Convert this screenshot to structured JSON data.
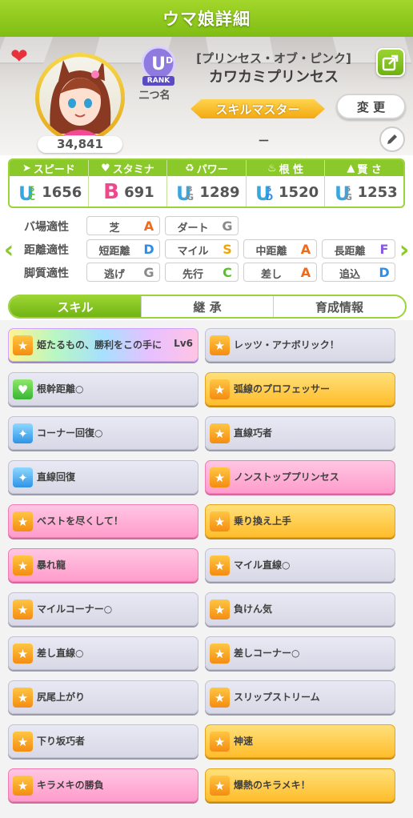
{
  "header": {
    "title": "ウマ娘詳細"
  },
  "profile": {
    "fans": "34,841",
    "rank_label": "RANK",
    "nickname": "二つ名",
    "epithet": "[プリンセス・オブ・ピンク]",
    "name": "カワカミプリンセス",
    "title_badge": "スキルマスター",
    "change_label": "変 更",
    "title_value": "－"
  },
  "stats": [
    {
      "label": "スピード",
      "grade": "UC5",
      "value": "1656"
    },
    {
      "label": "スタミナ",
      "grade": "B",
      "value": "691"
    },
    {
      "label": "パワー",
      "grade": "UG8",
      "value": "1289"
    },
    {
      "label": "根 性",
      "grade": "UD5",
      "value": "1520"
    },
    {
      "label": "賢 さ",
      "grade": "UG5",
      "value": "1253"
    }
  ],
  "aptitude": {
    "rows": [
      {
        "label": "バ場適性",
        "cells": [
          {
            "name": "芝",
            "grade": "A"
          },
          {
            "name": "ダート",
            "grade": "G"
          }
        ]
      },
      {
        "label": "距離適性",
        "cells": [
          {
            "name": "短距離",
            "grade": "D"
          },
          {
            "name": "マイル",
            "grade": "S"
          },
          {
            "name": "中距離",
            "grade": "A"
          },
          {
            "name": "長距離",
            "grade": "F"
          }
        ]
      },
      {
        "label": "脚質適性",
        "cells": [
          {
            "name": "逃げ",
            "grade": "G"
          },
          {
            "name": "先行",
            "grade": "C"
          },
          {
            "name": "差し",
            "grade": "A"
          },
          {
            "name": "追込",
            "grade": "D"
          }
        ]
      }
    ]
  },
  "tabs": [
    "スキル",
    "継 承",
    "育成情報"
  ],
  "skills": [
    {
      "name": "姫たるもの、勝利をこの手に",
      "level": "Lv6",
      "style": "rainbow",
      "icon": "yellow"
    },
    {
      "name": "レッツ・アナボリック！",
      "style": "normal",
      "icon": "yellow"
    },
    {
      "name": "根幹距離○",
      "style": "normal",
      "icon": "green"
    },
    {
      "name": "弧線のプロフェッサー",
      "style": "gold",
      "icon": "yellow"
    },
    {
      "name": "コーナー回復○",
      "style": "normal",
      "icon": "blue"
    },
    {
      "name": "直線巧者",
      "style": "normal",
      "icon": "yellow"
    },
    {
      "name": "直線回復",
      "style": "normal",
      "icon": "blue"
    },
    {
      "name": "ノンストッププリンセス",
      "style": "pink",
      "icon": "yellow"
    },
    {
      "name": "ベストを尽くして！",
      "style": "pink",
      "icon": "yellow"
    },
    {
      "name": "乗り換え上手",
      "style": "gold",
      "icon": "yellow"
    },
    {
      "name": "暴れ龍",
      "style": "pink",
      "icon": "yellow"
    },
    {
      "name": "マイル直線○",
      "style": "normal",
      "icon": "yellow"
    },
    {
      "name": "マイルコーナー○",
      "style": "normal",
      "icon": "yellow"
    },
    {
      "name": "負けん気",
      "style": "normal",
      "icon": "yellow"
    },
    {
      "name": "差し直線○",
      "style": "normal",
      "icon": "yellow"
    },
    {
      "name": "差しコーナー○",
      "style": "normal",
      "icon": "yellow"
    },
    {
      "name": "尻尾上がり",
      "style": "normal",
      "icon": "yellow"
    },
    {
      "name": "スリップストリーム",
      "style": "normal",
      "icon": "yellow"
    },
    {
      "name": "下り坂巧者",
      "style": "normal",
      "icon": "yellow"
    },
    {
      "name": "神速",
      "style": "gold",
      "icon": "yellow"
    },
    {
      "name": "キラメキの勝負",
      "style": "pink",
      "icon": "yellow"
    },
    {
      "name": "爆熱のキラメキ！",
      "style": "gold",
      "icon": "yellow"
    }
  ],
  "colors": {
    "accent": "#8bc92b",
    "grade_S": "#f0a500",
    "grade_A": "#ef6a1a",
    "grade_B": "#f0468c",
    "grade_C": "#5cbf2a",
    "grade_D": "#2e8de6",
    "grade_F": "#8a5be0",
    "grade_G": "#8a8a8a"
  }
}
